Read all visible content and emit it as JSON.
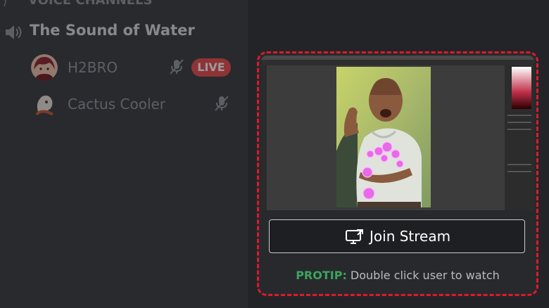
{
  "sidebar": {
    "cut_off_label": "VOICE CHANNELS",
    "channel": {
      "name": "The Sound of Water",
      "icon": "speaker-icon"
    },
    "users": [
      {
        "name": "H2BRO",
        "live": true,
        "live_label": "LIVE",
        "mute_icon": "mic-muted-icon"
      },
      {
        "name": "Cactus Cooler",
        "live": false,
        "mute_icon": "mic-muted-icon"
      }
    ]
  },
  "stream_panel": {
    "preview": {
      "description_icon": "photoshop-window-preview"
    },
    "join_button": {
      "label": "Join Stream",
      "icon": "screen-share-icon"
    },
    "protip": {
      "prefix": "PROTIP:",
      "text": " Double click user to watch"
    },
    "highlight_color": "#e0192a"
  },
  "colors": {
    "live_badge": "#ed4245",
    "protip_prefix": "#3ba55d",
    "background": "#202225"
  }
}
